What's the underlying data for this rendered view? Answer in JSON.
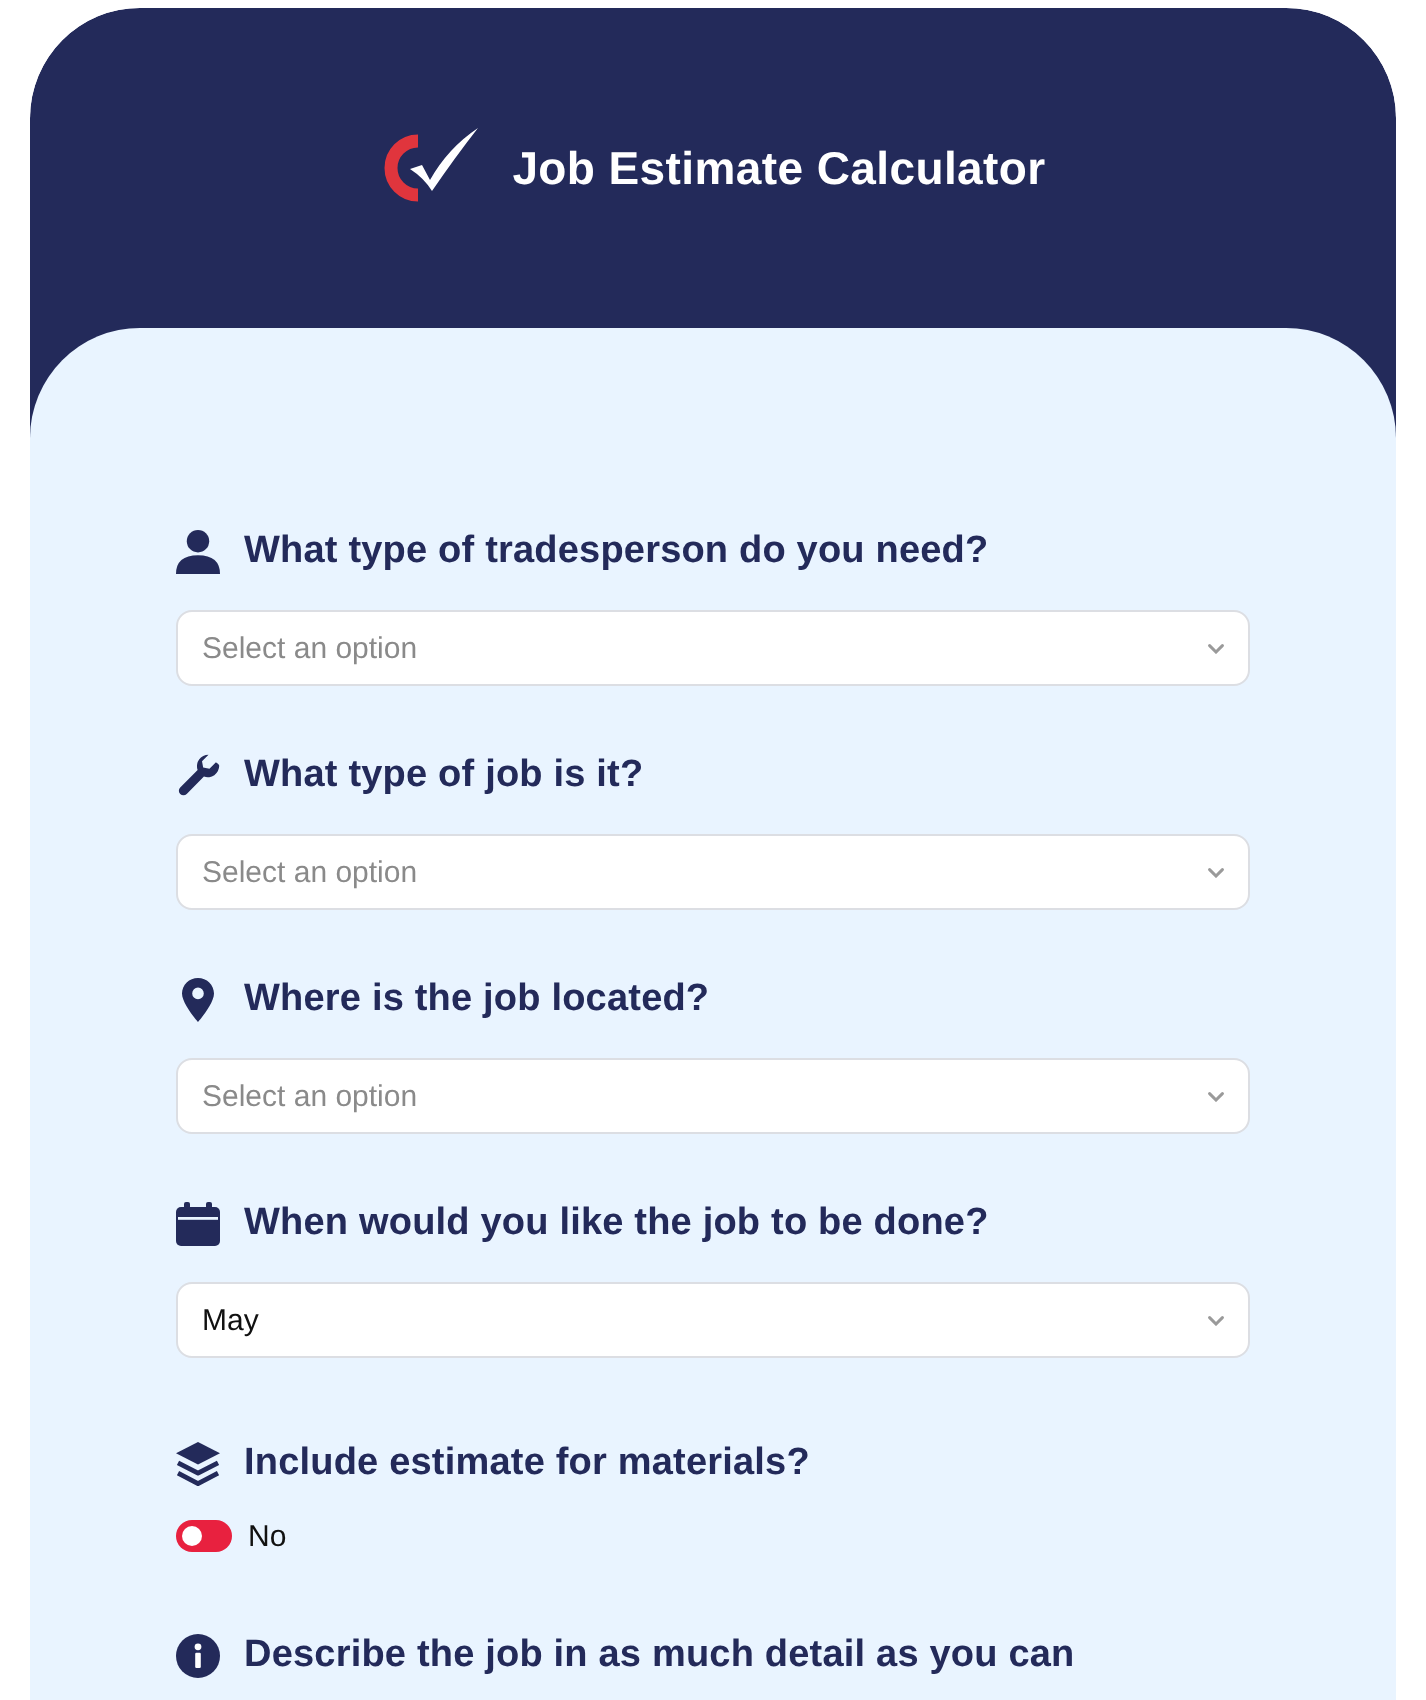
{
  "header": {
    "title": "Job Estimate Calculator"
  },
  "questions": [
    {
      "label": "What type of tradesperson do you need?",
      "control": {
        "kind": "select",
        "placeholder": "Select an option"
      }
    },
    {
      "label": "What type of job is it?",
      "control": {
        "kind": "select",
        "placeholder": "Select an option"
      }
    },
    {
      "label": "Where is the job located?",
      "control": {
        "kind": "select",
        "placeholder": "Select an option"
      }
    },
    {
      "label": "When would you like the job to be done?",
      "control": {
        "kind": "select",
        "value": "May"
      }
    },
    {
      "label": "Include estimate for materials?",
      "control": {
        "kind": "toggle",
        "on": false,
        "text": "No"
      }
    },
    {
      "label": "Describe the job in as much detail as you can"
    }
  ]
}
